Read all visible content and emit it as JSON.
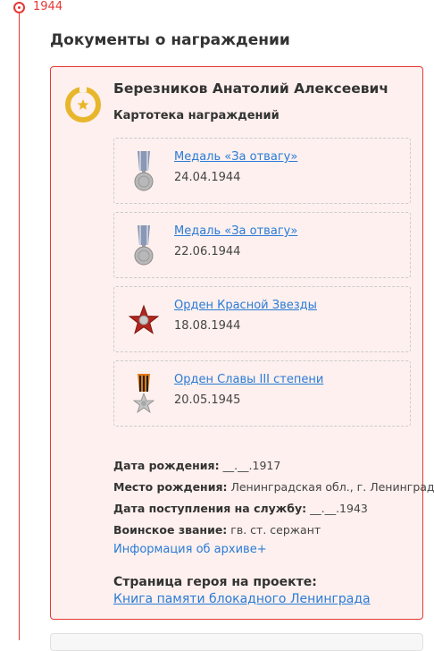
{
  "timeline": {
    "year": "1944"
  },
  "section": {
    "title": "Документы о награждении"
  },
  "card": {
    "name": "Березников Анатолий Алексеевич",
    "subtitle": "Картотека награждений",
    "awards": [
      {
        "name": "Медаль «За отвагу»",
        "date": "24.04.1944",
        "icon": "medal-for-courage-icon"
      },
      {
        "name": "Медаль «За отвагу»",
        "date": "22.06.1944",
        "icon": "medal-for-courage-icon"
      },
      {
        "name": "Орден Красной Звезды",
        "date": "18.08.1944",
        "icon": "order-red-star-icon"
      },
      {
        "name": "Орден Славы III степени",
        "date": "20.05.1945",
        "icon": "order-of-glory-icon"
      }
    ],
    "info": [
      {
        "label": "Дата рождения:",
        "value": "__.__.1917"
      },
      {
        "label": "Место рождения:",
        "value": "Ленинградская обл., г. Ленинград"
      },
      {
        "label": "Дата поступления на службу:",
        "value": "__.__.1943"
      },
      {
        "label": "Воинское звание:",
        "value": "гв. ст. сержант"
      }
    ],
    "archive_link": "Информация об архиве+",
    "hero_heading": "Страница героя на проекте:",
    "hero_link": "Книга памяти блокадного Ленинграда"
  },
  "colors": {
    "accent": "#e53935",
    "link": "#2a7bd6",
    "card_bg": "#fdf0ee",
    "badge": "#e8b62c"
  }
}
